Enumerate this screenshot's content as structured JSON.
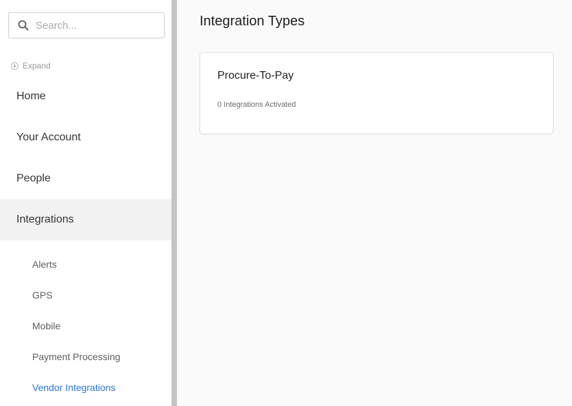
{
  "sidebar": {
    "search": {
      "placeholder": "Search...",
      "value": ""
    },
    "expand_label": "Expand",
    "nav": {
      "home": "Home",
      "your_account": "Your Account",
      "people": "People",
      "integrations": "Integrations"
    },
    "active_nav": "Integrations",
    "sub_items": {
      "alerts": "Alerts",
      "gps": "GPS",
      "mobile": "Mobile",
      "payment_processing": "Payment Processing",
      "vendor_integrations": "Vendor Integrations"
    },
    "selected_sub_item": "Vendor Integrations",
    "selected_color": "#2a74d6"
  },
  "main": {
    "title": "Integration Types",
    "cards": [
      {
        "title": "Procure-To-Pay",
        "subtitle": "0 Integrations Activated"
      }
    ]
  }
}
